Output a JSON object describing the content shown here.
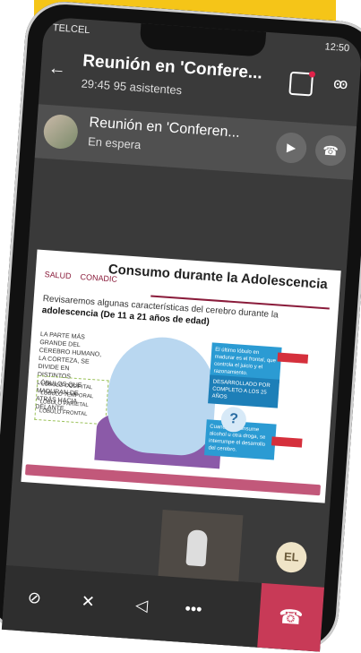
{
  "status": {
    "carrier": "TELCEL",
    "time": "12:50"
  },
  "header": {
    "title": "Reunión en 'Confere...",
    "subtitle": "29:45  95 asistentes"
  },
  "waiting": {
    "title": "Reunión en 'Conferen...",
    "status": "En espera"
  },
  "slide": {
    "logo1": "SALUD",
    "logo2": "CONADIC",
    "title": "Consumo durante la Adolescencia",
    "text": "Revisaremos algunas características del cerebro durante la",
    "text_bold": "adolescencia (De 11 a 21 años de edad)",
    "left_note": "LA PARTE MÁS GRANDE DEL CEREBRO HUMANO, LA CORTEZA, SE DIVIDE EN DISTINTOS LÓBULOS QUE MADURAN DE ATRÁS HACIA DELANTE.",
    "lobes": [
      "LÓBULO OCCIPITAL",
      "LÓBULO TEMPORAL",
      "LÓBULO PARIETAL",
      "LÓBULO FRONTAL"
    ],
    "box1": "El último lóbulo en madurar es el frontal, que controla el juicio y el razonamiento.",
    "box2": "DESARROLLADO POR COMPLETO A LOS 25 AÑOS",
    "box3": "Cuando se consume alcohol u otra droga, se interrumpe el desarrollo del cerebro.",
    "question": "?"
  },
  "participant": {
    "initials": "EL"
  },
  "controls": {
    "video": "video-off",
    "mic": "mic-off",
    "speaker": "speaker",
    "more": "•••",
    "hangup": "hang-up"
  }
}
